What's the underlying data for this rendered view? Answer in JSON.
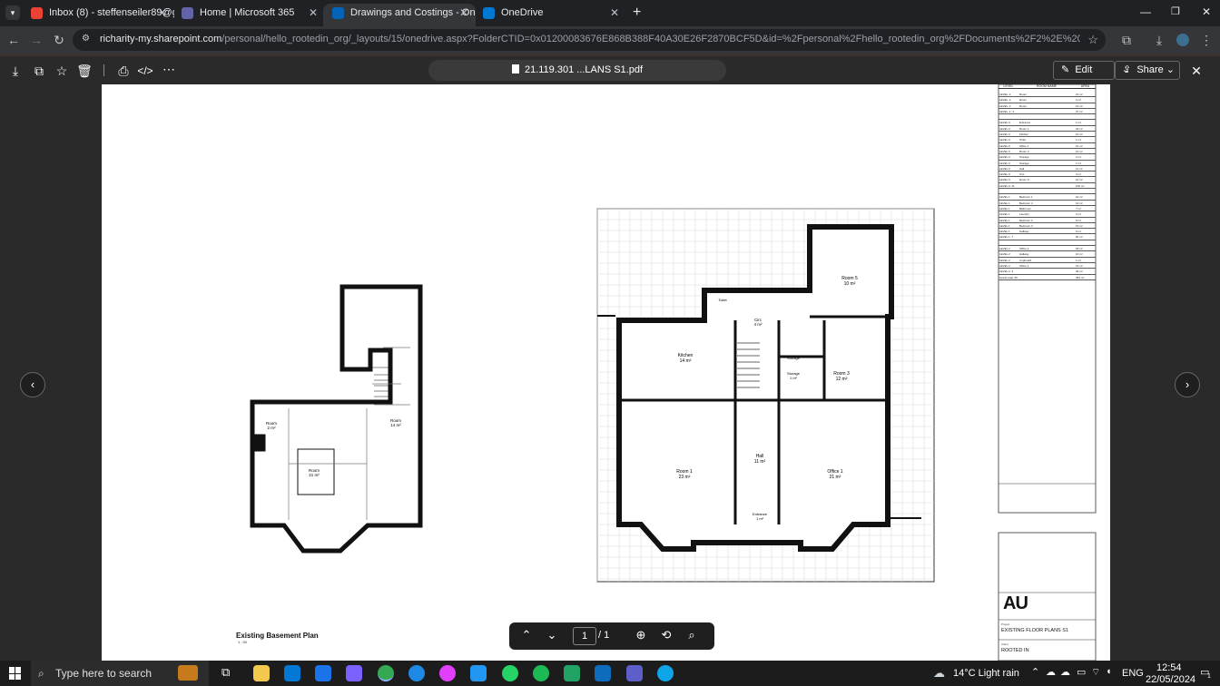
{
  "browser": {
    "tabs": [
      {
        "title": "Inbox (8) - steffenseiler89@gm",
        "favicon_color": "#ea4335",
        "active": false
      },
      {
        "title": "Home | Microsoft 365",
        "favicon_color": "#6264a7",
        "active": false
      },
      {
        "title": "Drawings and Costings - OneD",
        "favicon_color": "#0364b8",
        "active": true
      },
      {
        "title": "OneDrive",
        "favicon_color": "#0078d4",
        "active": false
      }
    ],
    "new_tab_label": "+",
    "url_host": "richarity-my.sharepoint.com",
    "url_path": "/personal/hello_rootedin_org/_layouts/15/onedrive.aspx?FolderCTID=0x01200083676E868B388F40A30E26F2870BCF5D&id=%2Fpersonal%2Fhello_rootedin_org%2FDocuments%2F2%2E%20ROOTED%20IN%20HOMES%20..."
  },
  "viewer": {
    "file_name": "21.119.301 ...LANS S1.pdf",
    "edit_label": "Edit",
    "share_label": "Share",
    "page_current": "1",
    "page_total": "/ 1"
  },
  "drawing": {
    "basement_title": "Existing Basement Plan",
    "basement_scale": "1 : 50",
    "rooms_ground": [
      {
        "name": "Kitchen",
        "area": "14 m²"
      },
      {
        "name": "Room 3",
        "area": "12 m²"
      },
      {
        "name": "Room 5",
        "area": "10 m²"
      },
      {
        "name": "Toilet",
        "area": ""
      },
      {
        "name": "Circ",
        "area": "4 m²"
      },
      {
        "name": "Storage",
        "area": ""
      },
      {
        "name": "Storage",
        "area": "1 m²"
      },
      {
        "name": "Room 1",
        "area": "23 m²"
      },
      {
        "name": "Hall",
        "area": "11 m²"
      },
      {
        "name": "Office 1",
        "area": "21 m²"
      },
      {
        "name": "Entrance",
        "area": "1 m²"
      }
    ],
    "rooms_basement": [
      {
        "name": "Room",
        "area": "2 m²"
      },
      {
        "name": "Room",
        "area": "14 m²"
      },
      {
        "name": "Room",
        "area": "21 m²"
      }
    ],
    "schedule_header": [
      "LEVEL",
      "ROOM NAME",
      "AREA"
    ],
    "schedule_rows": [
      [
        "LEVEL -1",
        "Room",
        "21 m²"
      ],
      [
        "LEVEL -1",
        "Room",
        "2 m²"
      ],
      [
        "LEVEL -1",
        "Room",
        "14 m²"
      ],
      [
        "LEVEL -1: 3",
        "",
        "37 m²"
      ],
      [
        "",
        "",
        ""
      ],
      [
        "LEVEL 0",
        "Entrance",
        "1 m²"
      ],
      [
        "LEVEL 0",
        "Room 1",
        "23 m²"
      ],
      [
        "LEVEL 0",
        "Kitchen",
        "14 m²"
      ],
      [
        "LEVEL 0",
        "Toilet",
        "1 m²"
      ],
      [
        "LEVEL 0",
        "Office 1",
        "21 m²"
      ],
      [
        "LEVEL 0",
        "Room 3",
        "12 m²"
      ],
      [
        "LEVEL 0",
        "Storage",
        "2 m²"
      ],
      [
        "LEVEL 0",
        "Storage",
        "1 m²"
      ],
      [
        "LEVEL 0",
        "Hall",
        "11 m²"
      ],
      [
        "LEVEL 0",
        "Circ",
        "4 m²"
      ],
      [
        "LEVEL 0",
        "Room 5",
        "10 m²"
      ],
      [
        "LEVEL 0: 11",
        "",
        "100 m²"
      ],
      [
        "",
        "",
        ""
      ],
      [
        "LEVEL 1",
        "Bedroom 1",
        "21 m²"
      ],
      [
        "LEVEL 1",
        "Bedroom 4",
        "14 m²"
      ],
      [
        "LEVEL 1",
        "Bathroom",
        "7 m²"
      ],
      [
        "LEVEL 1",
        "Laundry",
        "3 m²"
      ],
      [
        "LEVEL 1",
        "Bedroom 2",
        "8 m²"
      ],
      [
        "LEVEL 1",
        "Bedroom 3",
        "16 m²"
      ],
      [
        "LEVEL 1",
        "Hallway",
        "9 m²"
      ],
      [
        "LEVEL 1: 7",
        "",
        "81 m²"
      ],
      [
        "",
        "",
        ""
      ],
      [
        "LEVEL 2",
        "Office 2",
        "18 m²"
      ],
      [
        "LEVEL 2",
        "Hallway",
        "10 m²"
      ],
      [
        "LEVEL 2",
        "Cupboard",
        "1 m²"
      ],
      [
        "LEVEL 2",
        "Office 1",
        "16 m²"
      ],
      [
        "LEVEL 2: 4",
        "",
        "46 m²"
      ],
      [
        "Grand total: 25",
        "",
        "264 m²"
      ]
    ],
    "logo_text": "AU",
    "project_label": "Project",
    "project_title": "EXISTING FLOOR PLANS S1",
    "client_label": "Client",
    "client_name": "ROOTED IN"
  },
  "taskbar": {
    "search_placeholder": "Type here to search",
    "weather": "14°C  Light rain",
    "language": "ENG",
    "time": "12:54",
    "date": "22/05/2024",
    "notification_count": "1"
  },
  "colors": {
    "accent": "#8ab4f8",
    "taskbar": "#1c1c1c",
    "viewer_bg": "#2a2a2a"
  }
}
